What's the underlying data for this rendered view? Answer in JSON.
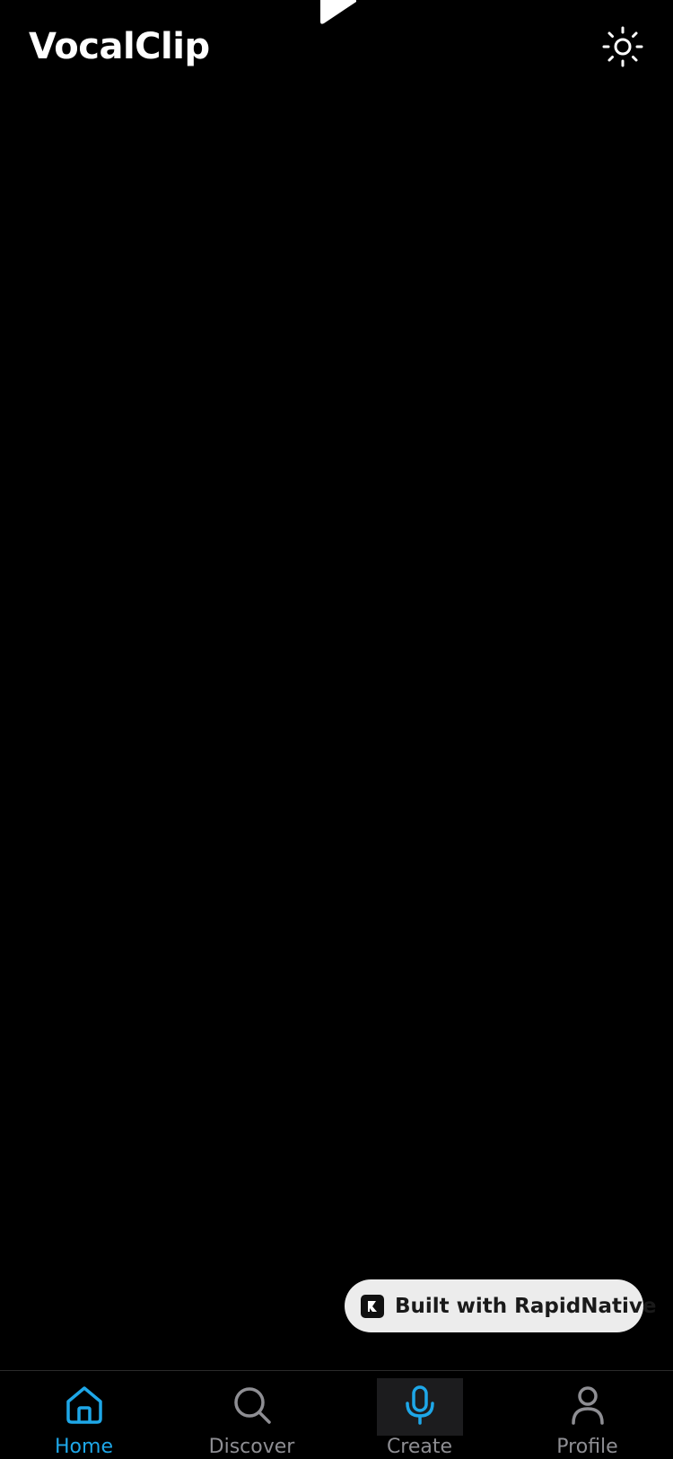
{
  "header": {
    "app_title": "VocalClip",
    "theme_icon": "sun-icon"
  },
  "badge": {
    "label": "Built with RapidNative",
    "icon": "rapidnative-logo-icon"
  },
  "tab_bar": {
    "tabs": [
      {
        "label": "Home",
        "icon": "home-icon",
        "active": true
      },
      {
        "label": "Discover",
        "icon": "search-icon",
        "active": false
      },
      {
        "label": "Create",
        "icon": "microphone-icon",
        "active": false
      },
      {
        "label": "Profile",
        "icon": "person-icon",
        "active": false
      }
    ]
  },
  "colors": {
    "background": "#000000",
    "accent": "#1ea7e8",
    "inactive": "#8e8e93",
    "badge_bg": "#ececec"
  }
}
